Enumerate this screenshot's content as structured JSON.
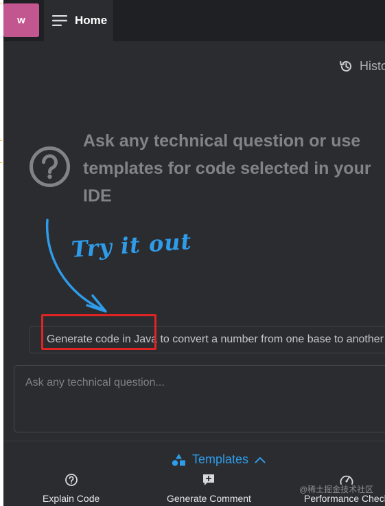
{
  "header": {
    "avatar_letter": "w",
    "home_label": "Home"
  },
  "history": {
    "label": "History"
  },
  "main": {
    "prompt": "Ask any technical question or use templates for code selected in your IDE",
    "try_it_out": "Try it out",
    "suggestion": "Generate code in Java to convert a number from one base to another"
  },
  "input": {
    "placeholder": "Ask any technical question..."
  },
  "templates": {
    "label": "Templates",
    "items": [
      {
        "label": "Explain Code",
        "icon": "question-icon"
      },
      {
        "label": "Generate Comment",
        "icon": "comment-plus-icon"
      },
      {
        "label": "Performance Check",
        "icon": "gauge-icon"
      }
    ]
  },
  "watermark": "@稀土掘金技术社区",
  "colors": {
    "accent": "#2e9cea",
    "avatar": "#c2568f",
    "highlight": "#e02424"
  }
}
